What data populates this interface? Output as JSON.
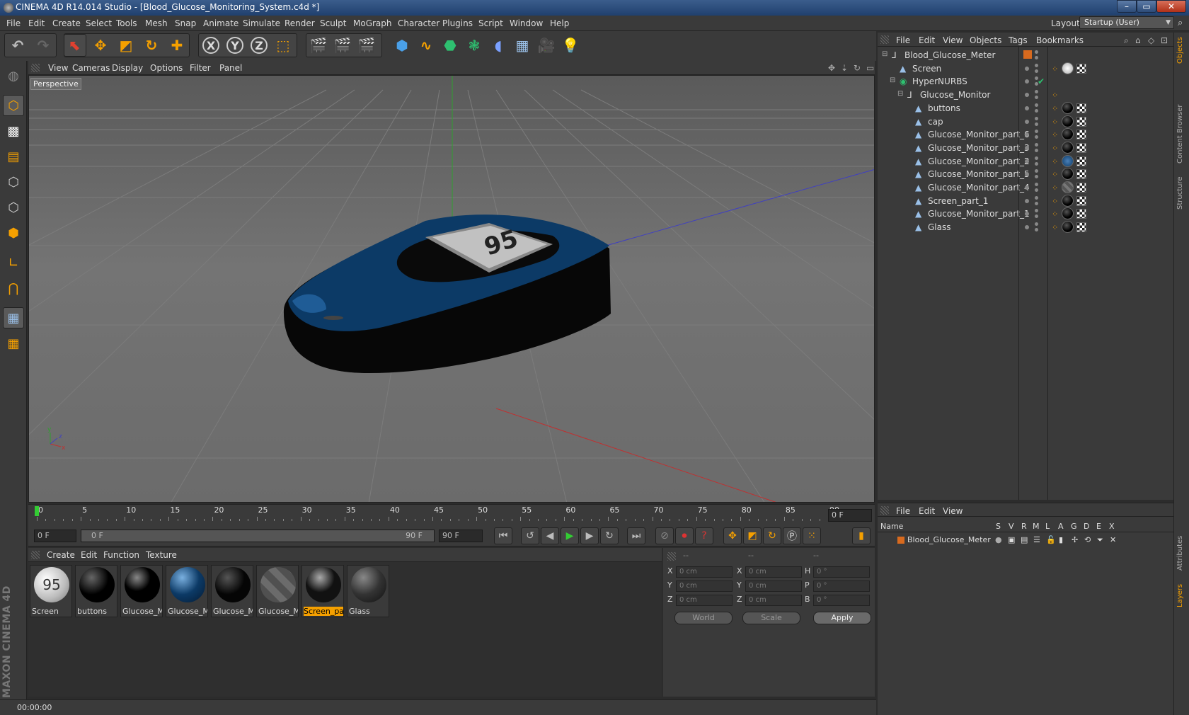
{
  "window": {
    "title": "CINEMA 4D R14.014 Studio - [Blood_Glucose_Monitoring_System.c4d *]",
    "min": "–",
    "max": "▭",
    "close": "✕"
  },
  "menubar": {
    "items": [
      "File",
      "Edit",
      "Create",
      "Select",
      "Tools",
      "Mesh",
      "Snap",
      "Animate",
      "Simulate",
      "Render",
      "Sculpt",
      "MoGraph",
      "Character",
      "Plugins",
      "Script",
      "Window",
      "Help"
    ],
    "layout_label": "Layout:",
    "layout_value": "Startup (User)"
  },
  "toolbar": {
    "x_label": "X",
    "y_label": "Y",
    "z_label": "Z"
  },
  "viewport": {
    "menu": [
      "View",
      "Cameras",
      "Display",
      "Options",
      "Filter",
      "Panel"
    ],
    "camera": "Perspective",
    "display_digits": "95"
  },
  "timeline": {
    "ticks": [
      "0",
      "5",
      "10",
      "15",
      "20",
      "25",
      "30",
      "35",
      "40",
      "45",
      "50",
      "55",
      "60",
      "65",
      "70",
      "75",
      "80",
      "85",
      "90"
    ],
    "current_frame": "0 F"
  },
  "transport": {
    "start": "0 F",
    "range_start": "0 F",
    "range_end": "90 F",
    "end": "90 F"
  },
  "materials": {
    "menu": [
      "Create",
      "Edit",
      "Function",
      "Texture"
    ],
    "items": [
      {
        "label": "Screen",
        "active": false
      },
      {
        "label": "buttons",
        "active": false
      },
      {
        "label": "Glucose_M",
        "active": false
      },
      {
        "label": "Glucose_M",
        "active": false
      },
      {
        "label": "Glucose_M",
        "active": false
      },
      {
        "label": "Glucose_M",
        "active": false
      },
      {
        "label": "Screen_par",
        "active": true
      },
      {
        "label": "Glass",
        "active": false
      }
    ]
  },
  "coords": {
    "headers": [
      "--",
      "--",
      "--"
    ],
    "rows": [
      {
        "a": "X",
        "av": "0 cm",
        "b": "X",
        "bv": "0 cm",
        "c": "H",
        "cv": "0 °"
      },
      {
        "a": "Y",
        "av": "0 cm",
        "b": "Y",
        "bv": "0 cm",
        "c": "P",
        "cv": "0 °"
      },
      {
        "a": "Z",
        "av": "0 cm",
        "b": "Z",
        "bv": "0 cm",
        "c": "B",
        "cv": "0 °"
      }
    ],
    "space": "World",
    "mode": "Scale",
    "apply": "Apply"
  },
  "status": {
    "time": "00:00:00"
  },
  "objects": {
    "menu": [
      "File",
      "Edit",
      "View",
      "Objects",
      "Tags",
      "Bookmarks"
    ],
    "items": [
      {
        "name": "Blood_Glucose_Meter",
        "indent": 0,
        "type": "null"
      },
      {
        "name": "Screen",
        "indent": 1,
        "type": "poly"
      },
      {
        "name": "HyperNURBS",
        "indent": 1,
        "type": "nurbs"
      },
      {
        "name": "Glucose_Monitor",
        "indent": 2,
        "type": "null"
      },
      {
        "name": "buttons",
        "indent": 3,
        "type": "poly"
      },
      {
        "name": "cap",
        "indent": 3,
        "type": "poly"
      },
      {
        "name": "Glucose_Monitor_part_6",
        "indent": 3,
        "type": "poly"
      },
      {
        "name": "Glucose_Monitor_part_3",
        "indent": 3,
        "type": "poly"
      },
      {
        "name": "Glucose_Monitor_part_2",
        "indent": 3,
        "type": "poly"
      },
      {
        "name": "Glucose_Monitor_part_5",
        "indent": 3,
        "type": "poly"
      },
      {
        "name": "Glucose_Monitor_part_4",
        "indent": 3,
        "type": "poly"
      },
      {
        "name": "Screen_part_1",
        "indent": 3,
        "type": "poly"
      },
      {
        "name": "Glucose_Monitor_part_1",
        "indent": 3,
        "type": "poly"
      },
      {
        "name": "Glass",
        "indent": 3,
        "type": "poly"
      }
    ]
  },
  "layers": {
    "menu": [
      "File",
      "Edit",
      "View"
    ],
    "columns": [
      "Name",
      "S",
      "V",
      "R",
      "M",
      "L",
      "A",
      "G",
      "D",
      "E",
      "X"
    ],
    "row": "Blood_Glucose_Meter"
  },
  "sidetabs": [
    "Objects",
    "Content Browser",
    "Structure",
    "Attributes",
    "Layers"
  ],
  "brand": "MAXON CINEMA 4D",
  "colors": {
    "accent": "#f5a000",
    "layer": "#d86a1e",
    "device_blue": "#0c3a66"
  }
}
